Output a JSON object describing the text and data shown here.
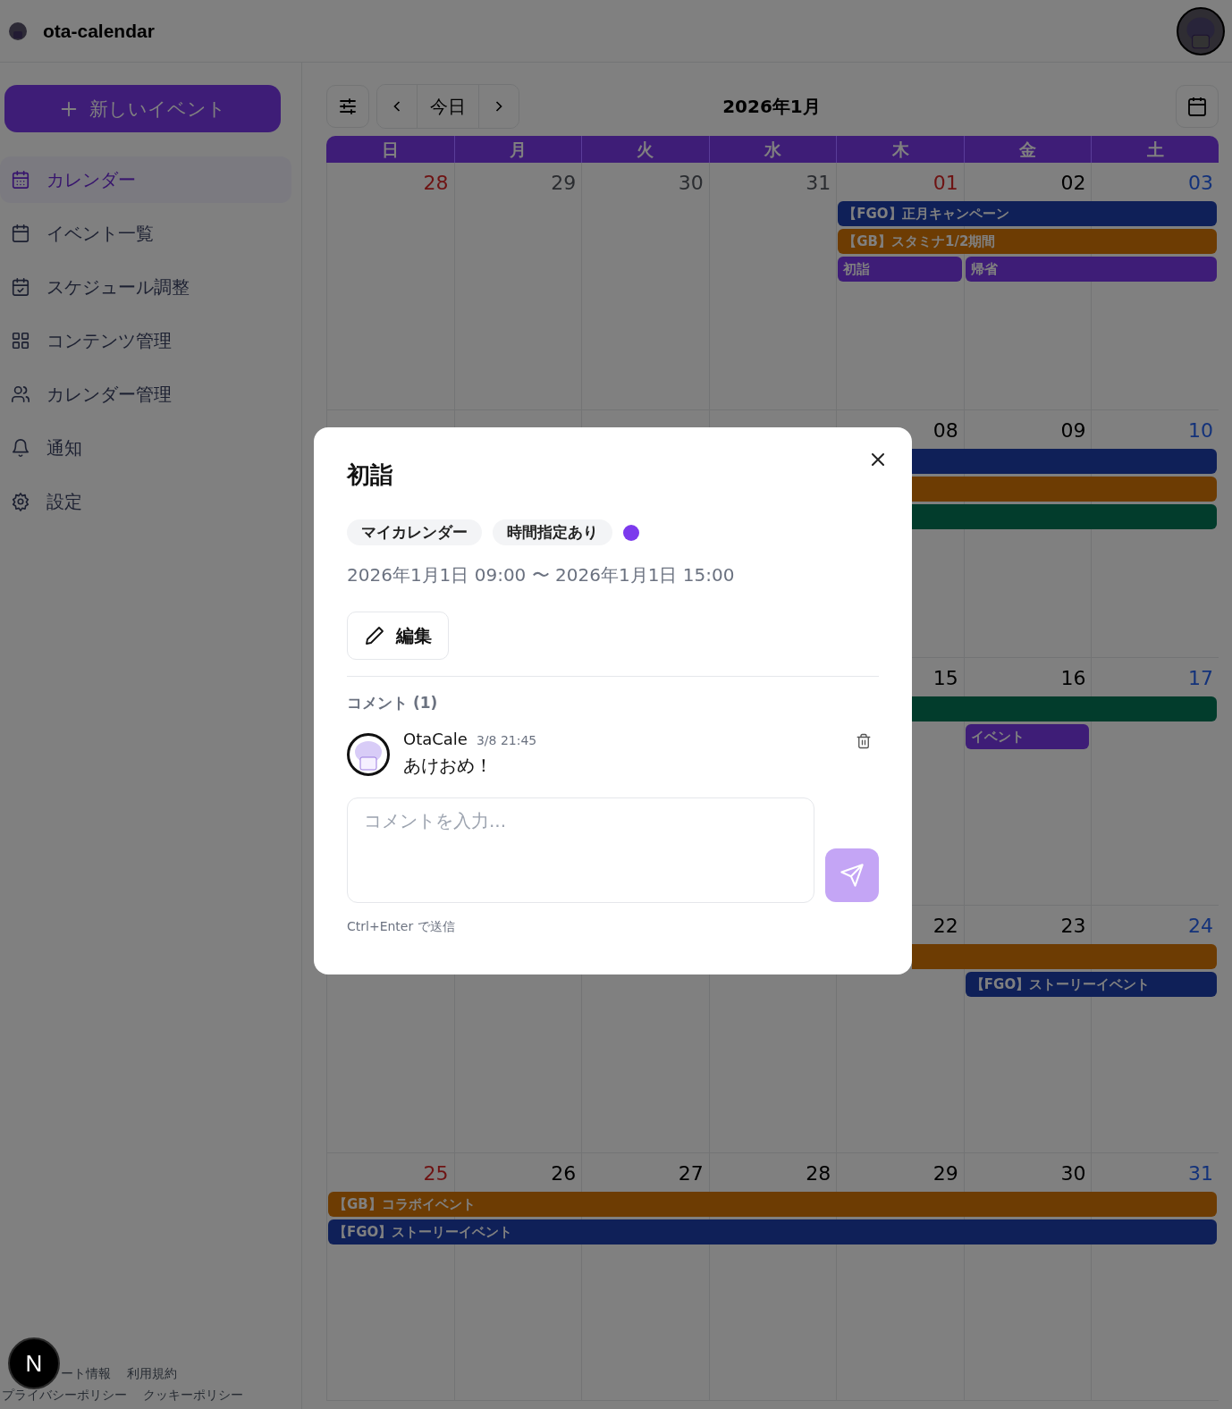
{
  "app": {
    "title": "ota-calendar"
  },
  "sidebar": {
    "new_event_button": "新しいイベント",
    "items": [
      {
        "label": "カレンダー",
        "kind": "calendar-days",
        "selected": true
      },
      {
        "label": "イベント一覧",
        "kind": "calendar",
        "selected": false
      },
      {
        "label": "スケジュール調整",
        "kind": "calendar-check",
        "selected": false
      },
      {
        "label": "コンテンツ管理",
        "kind": "grid",
        "selected": false
      },
      {
        "label": "カレンダー管理",
        "kind": "users",
        "selected": false
      },
      {
        "label": "通知",
        "kind": "bell",
        "selected": false
      },
      {
        "label": "設定",
        "kind": "gear",
        "selected": false
      }
    ],
    "footer_rows": [
      {
        "links": [
          "ート情報",
          "利用規約"
        ]
      },
      {
        "links": [
          "プライバシーポリシー",
          "クッキーポリシー"
        ]
      }
    ]
  },
  "dev_badge": "N",
  "toolbar": {
    "today_button": "今日",
    "month_title": "2026年1月"
  },
  "calendar": {
    "weekdays": [
      "日",
      "月",
      "火",
      "水",
      "木",
      "金",
      "土"
    ],
    "weeks": [
      {
        "days": [
          {
            "date": "28",
            "kind": "holiday"
          },
          {
            "date": "29",
            "kind": "outside"
          },
          {
            "date": "30",
            "kind": "outside"
          },
          {
            "date": "31",
            "kind": "outside"
          },
          {
            "date": "01",
            "kind": "holiday",
            "events": [
              {
                "label": "【FGO】正月キャンペーン",
                "color": "#0f2058",
                "to_week_end": true
              },
              {
                "label": "【GB】スタミナ1/2期間",
                "color": "#6d3c03",
                "to_week_end": true
              },
              {
                "label": "初詣",
                "color": "#3e1d77",
                "to_week_end": false
              }
            ]
          },
          {
            "date": "02",
            "kind": "weekday",
            "events": [
              {
                "label": "帰省",
                "color": "#3e1d77",
                "to_week_end": true
              }
            ]
          },
          {
            "date": "03",
            "kind": "saturday"
          }
        ]
      },
      {
        "days": [
          {
            "date": "08",
            "kind": "weekday",
            "events": [
              {
                "color": "#0f2058",
                "to_week_end": true
              },
              {
                "color": "#6d3c03",
                "to_week_end": true
              },
              {
                "color": "#023c2c",
                "to_week_end": true
              }
            ]
          },
          {
            "date": "09",
            "kind": "weekday"
          },
          {
            "date": "10",
            "kind": "saturday"
          }
        ]
      },
      {
        "days": [
          {
            "date": "15",
            "kind": "weekday",
            "events": [
              {
                "color": "#023c2c",
                "to_week_end": true
              }
            ]
          },
          {
            "date": "16",
            "kind": "weekday",
            "events": [
              {
                "label": "イベント",
                "color": "#3e1d77",
                "to_week_end": false
              }
            ]
          },
          {
            "date": "17",
            "kind": "saturday"
          }
        ]
      },
      {
        "days": [
          {
            "date": "22",
            "kind": "weekday",
            "events": [
              {
                "color": "#6d3c03",
                "to_week_end": true
              }
            ]
          },
          {
            "date": "23",
            "kind": "weekday",
            "events": [
              {
                "label": "【FGO】ストーリーイベント",
                "color": "#0f2058",
                "to_week_end": true
              }
            ]
          },
          {
            "date": "24",
            "kind": "saturday"
          }
        ]
      },
      {
        "days": [
          {
            "date": "25",
            "kind": "holiday",
            "events": [
              {
                "label": "【GB】コラボイベント",
                "color": "#6d3c03",
                "to_week_end": true
              },
              {
                "label": "【FGO】ストーリーイベント",
                "color": "#0f2058",
                "to_week_end": true
              }
            ]
          },
          {
            "date": "26",
            "kind": "weekday"
          },
          {
            "date": "27",
            "kind": "weekday"
          },
          {
            "date": "28",
            "kind": "weekday"
          },
          {
            "date": "29",
            "kind": "weekday"
          },
          {
            "date": "30",
            "kind": "weekday"
          },
          {
            "date": "31",
            "kind": "saturday"
          }
        ]
      }
    ]
  },
  "event_dialog": {
    "title": "初詣",
    "tags": [
      "マイカレンダー",
      "時間指定あり"
    ],
    "color": "#7c3aed",
    "datetime": "2026年1月1日 09:00 〜 2026年1月1日 15:00",
    "edit_button": "編集",
    "comments_heading": "コメント (1)",
    "comments": [
      {
        "author": "OtaCale",
        "time": "3/8 21:45",
        "text": "あけおめ！"
      }
    ],
    "comment_input": {
      "placeholder": "コメントを入力..."
    },
    "hint": "Ctrl+Enter で送信"
  }
}
